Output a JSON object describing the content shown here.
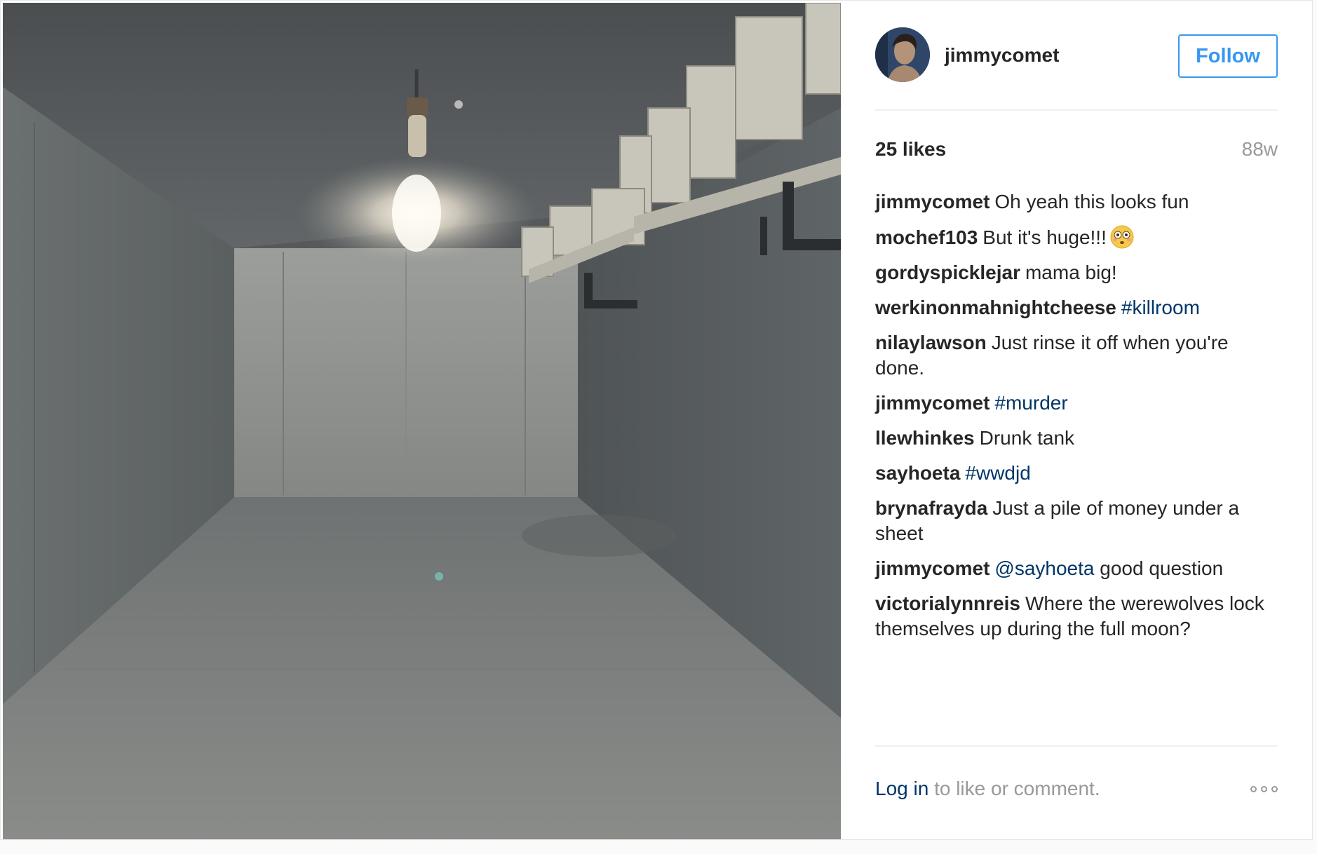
{
  "post": {
    "username": "jimmycomet",
    "follow_label": "Follow",
    "likes": "25 likes",
    "age": "88w",
    "comments": [
      {
        "user": "jimmycomet",
        "parts": [
          {
            "t": "Oh yeah this looks fun"
          }
        ]
      },
      {
        "user": "mochef103",
        "parts": [
          {
            "t": "But it's huge!!!"
          }
        ],
        "emoji": "flushed-face"
      },
      {
        "user": "gordyspicklejar",
        "parts": [
          {
            "t": "mama big!"
          }
        ]
      },
      {
        "user": "werkinonmahnightcheese",
        "parts": [
          {
            "t": "#killroom",
            "tag": true
          }
        ]
      },
      {
        "user": "nilaylawson",
        "parts": [
          {
            "t": "Just rinse it off when you're done."
          }
        ]
      },
      {
        "user": "jimmycomet",
        "parts": [
          {
            "t": "#murder",
            "tag": true
          }
        ]
      },
      {
        "user": "llewhinkes",
        "parts": [
          {
            "t": "Drunk tank"
          }
        ]
      },
      {
        "user": "sayhoeta",
        "parts": [
          {
            "t": "#wwdjd",
            "tag": true
          }
        ]
      },
      {
        "user": "brynafrayda",
        "parts": [
          {
            "t": "Just a pile of money under a sheet"
          }
        ]
      },
      {
        "user": "jimmycomet",
        "parts": [
          {
            "t": "@sayhoeta",
            "tag": true
          },
          {
            "t": " good question"
          }
        ]
      },
      {
        "user": "victorialynnreis",
        "parts": [
          {
            "t": "Where the werewolves lock themselves up during the full moon?"
          }
        ]
      }
    ],
    "footer": {
      "login_link": "Log in",
      "login_rest": " to like or comment.",
      "more_icon": "ellipsis-icon"
    }
  },
  "colors": {
    "follow_blue": "#3897f0",
    "link_blue": "#003569",
    "text": "#262626",
    "muted": "#999999"
  }
}
